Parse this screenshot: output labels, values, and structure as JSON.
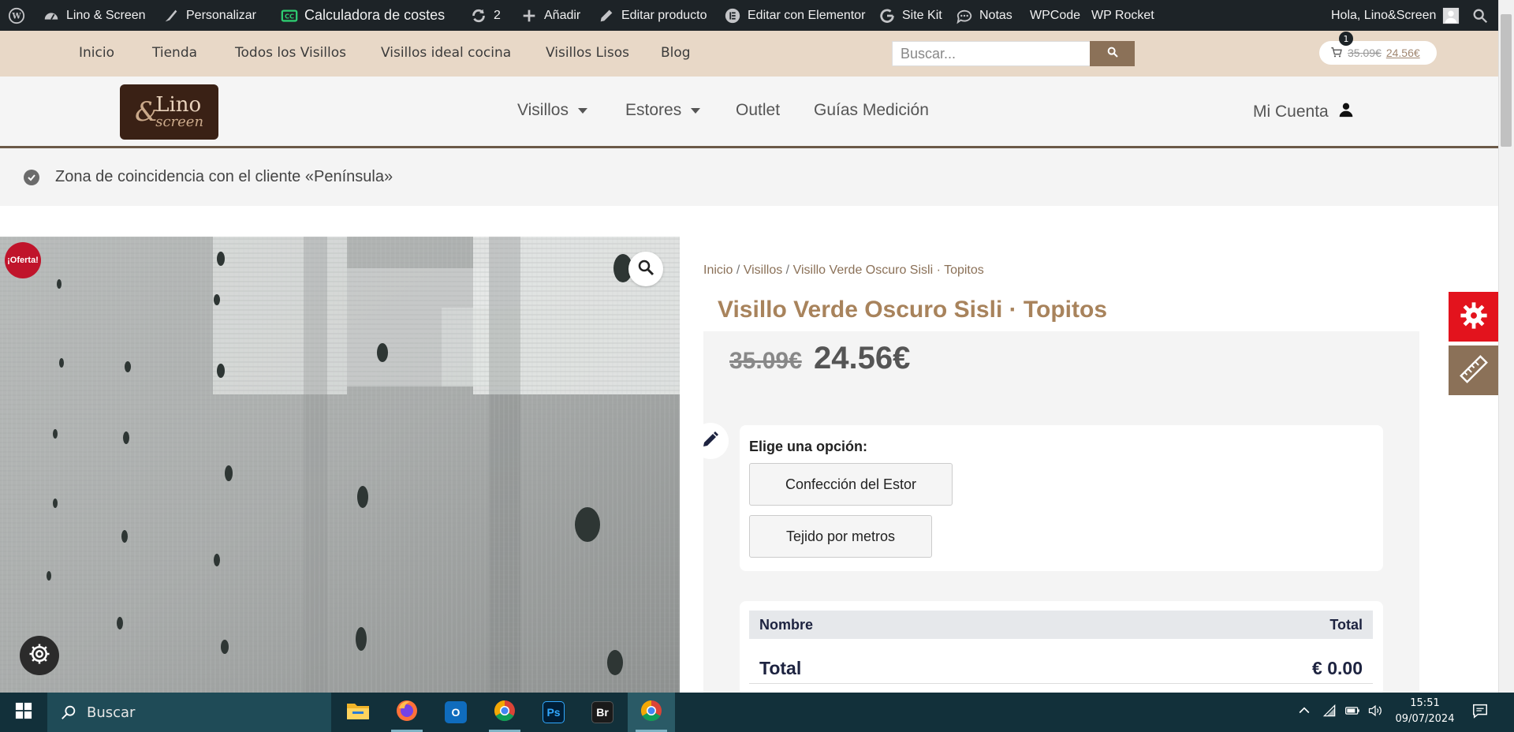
{
  "admin_bar": {
    "items": [
      {
        "label": ""
      },
      {
        "label": "Lino & Screen"
      },
      {
        "label": "Personalizar"
      },
      {
        "label": "Calculadora de costes"
      },
      {
        "label": "2"
      },
      {
        "label": "Añadir"
      },
      {
        "label": "Editar producto"
      },
      {
        "label": "Editar con Elementor"
      },
      {
        "label": "Site Kit"
      },
      {
        "label": "Notas"
      },
      {
        "label": "WPCode"
      },
      {
        "label": "WP Rocket"
      }
    ],
    "greeting": "Hola, Lino&Screen"
  },
  "top_nav": {
    "links": [
      "Inicio",
      "Tienda",
      "Todos los Visillos",
      "Visillos ideal cocina",
      "Visillos Lisos",
      "Blog"
    ],
    "search_placeholder": "Buscar...",
    "cart": {
      "count": "1",
      "old_price": "35.09€",
      "new_price": "24.56€"
    }
  },
  "main_nav": {
    "logo_text": "Lino",
    "logo_subtext": "screen",
    "items": [
      {
        "label": "Visillos",
        "has_dropdown": true
      },
      {
        "label": "Estores",
        "has_dropdown": true
      },
      {
        "label": "Outlet",
        "has_dropdown": false
      },
      {
        "label": "Guías Medición",
        "has_dropdown": false
      }
    ],
    "account_label": "Mi Cuenta"
  },
  "notice": {
    "text": "Zona de coincidencia con el cliente «Península»"
  },
  "product": {
    "sale_badge": "¡Oferta!",
    "breadcrumb": [
      "Inicio",
      "Visillos",
      "Visillo Verde Oscuro Sisli · Topitos"
    ],
    "breadcrumb_sep": "/",
    "title": "Visillo Verde Oscuro Sisli · Topitos",
    "old_price": "35.09€",
    "price": "24.56€",
    "option_label": "Elige una opción:",
    "options": [
      "Confección del Estor",
      "Tejido por metros"
    ],
    "totals": {
      "col_name": "Nombre",
      "col_total": "Total",
      "total_label": "Total",
      "total_value": "€ 0.00"
    }
  },
  "colors": {
    "admin_bg": "#1d2327",
    "topbar_bg": "#e8d8c7",
    "accent_brown": "#8b7158",
    "title_gold": "#a8835c",
    "gear_red": "#e3131d",
    "taskbar_bg": "#12303a"
  },
  "taskbar": {
    "search_placeholder": "Buscar",
    "apps": [
      "file-explorer",
      "firefox",
      "outlook",
      "chrome",
      "photoshop",
      "bridge",
      "chrome-profile"
    ],
    "time": "15:51",
    "date": "09/07/2024"
  }
}
